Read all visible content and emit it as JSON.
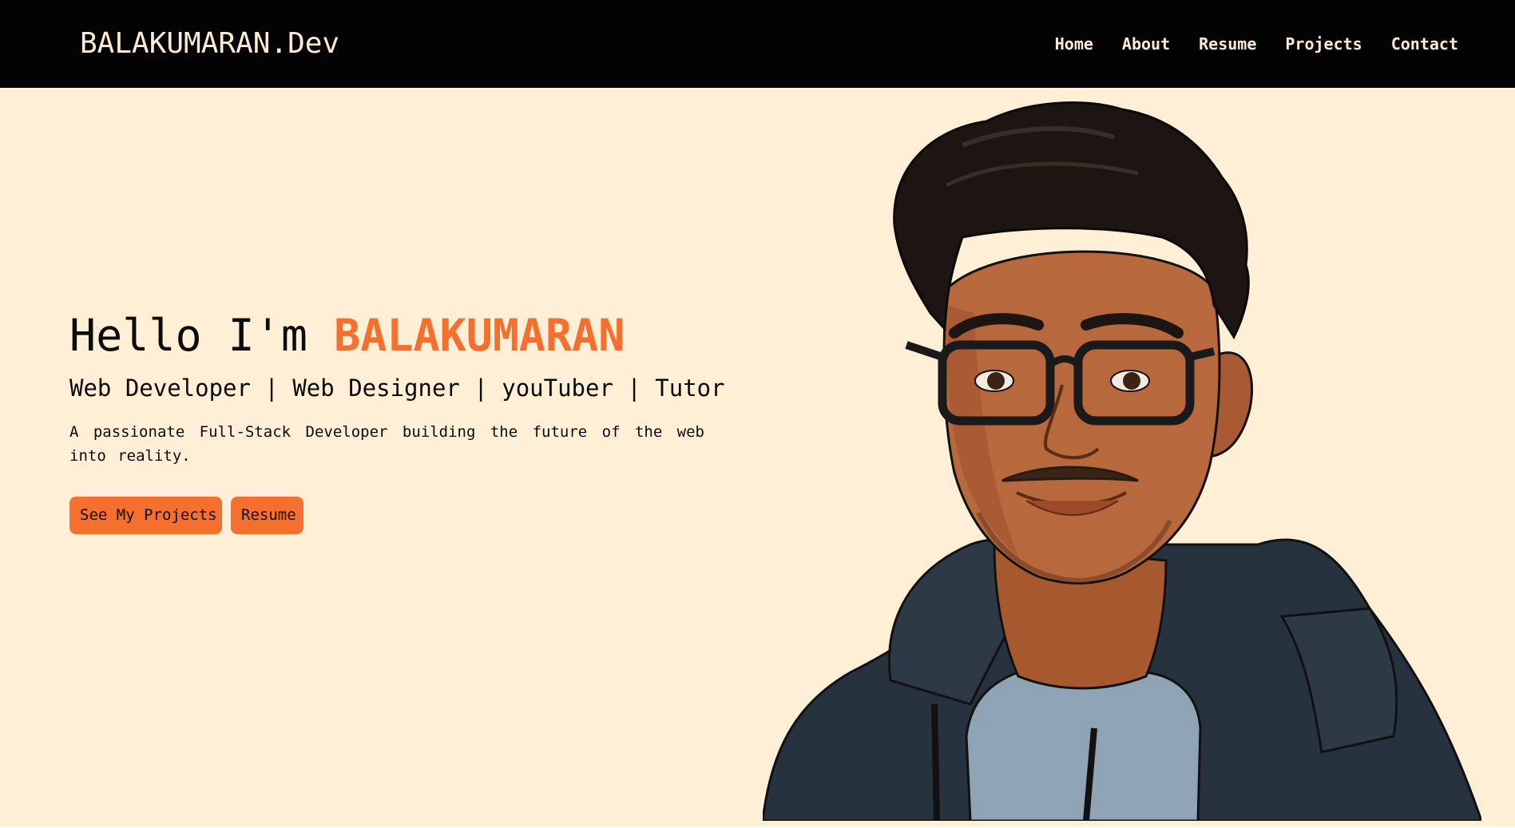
{
  "navbar": {
    "brand": "BALAKUMARAN.Dev",
    "links": [
      "Home",
      "About",
      "Resume",
      "Projects",
      "Contact"
    ]
  },
  "hero": {
    "greeting": "Hello I'm ",
    "name": "BALAKUMARAN",
    "roles": "Web Developer | Web Designer | youTuber | Tutor",
    "tagline": "A passionate Full-Stack Developer building the future of the web into reality.",
    "buttons": {
      "projects": "See My Projects",
      "resume": "Resume"
    }
  },
  "colors": {
    "navbar_bg": "#030303",
    "hero_bg": "#ffefd6",
    "accent": "#f56f2e",
    "nav_text": "#fdebd3"
  },
  "portrait": {
    "alt": "illustrated-avatar"
  }
}
